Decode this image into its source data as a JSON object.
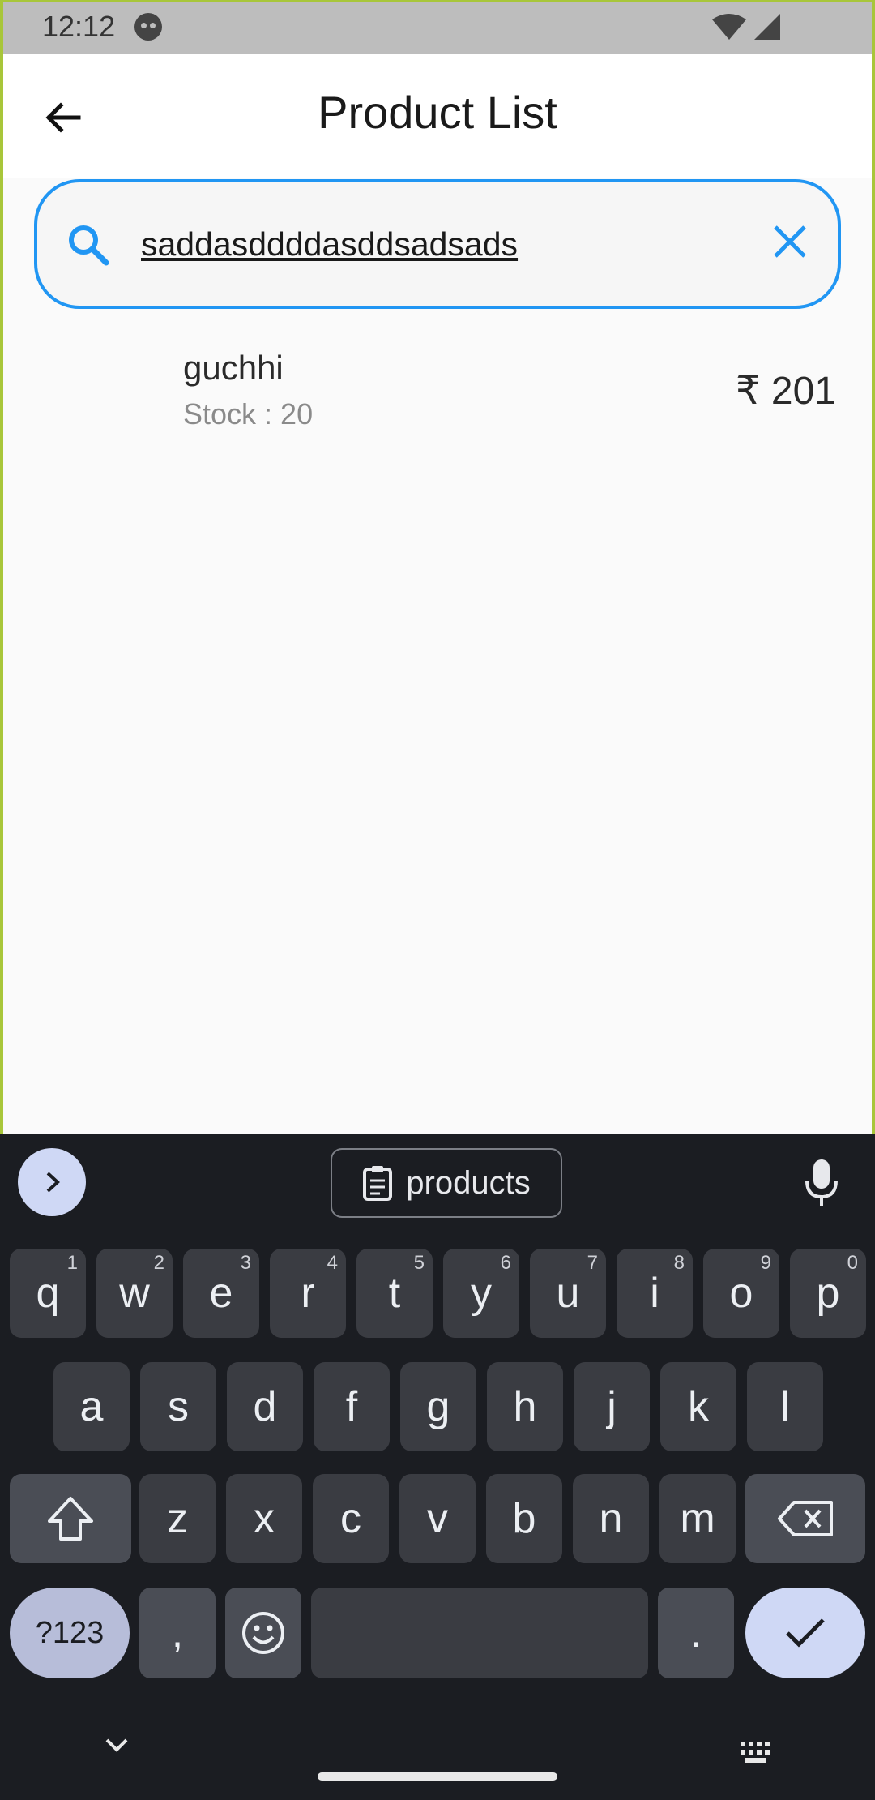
{
  "status_bar": {
    "time": "12:12"
  },
  "app_bar": {
    "title": "Product List"
  },
  "search": {
    "value": "saddasddddasddsadsads"
  },
  "products": [
    {
      "name": "guchhi",
      "stock": "Stock : 20",
      "price": "₹ 201"
    }
  ],
  "keyboard": {
    "suggestion": "products",
    "row1": [
      {
        "k": "q",
        "h": "1"
      },
      {
        "k": "w",
        "h": "2"
      },
      {
        "k": "e",
        "h": "3"
      },
      {
        "k": "r",
        "h": "4"
      },
      {
        "k": "t",
        "h": "5"
      },
      {
        "k": "y",
        "h": "6"
      },
      {
        "k": "u",
        "h": "7"
      },
      {
        "k": "i",
        "h": "8"
      },
      {
        "k": "o",
        "h": "9"
      },
      {
        "k": "p",
        "h": "0"
      }
    ],
    "row2": [
      "a",
      "s",
      "d",
      "f",
      "g",
      "h",
      "j",
      "k",
      "l"
    ],
    "row3": [
      "z",
      "x",
      "c",
      "v",
      "b",
      "n",
      "m"
    ],
    "symbols_label": "?123",
    "comma": ",",
    "period": "."
  },
  "colors": {
    "accent": "#2196f3",
    "keyboard_bg": "#1b1d22",
    "key_bg": "#3a3c42"
  }
}
